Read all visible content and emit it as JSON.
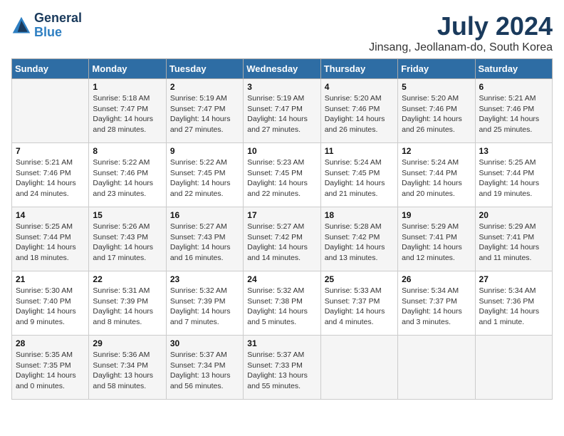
{
  "logo": {
    "general": "General",
    "blue": "Blue"
  },
  "header": {
    "month": "July 2024",
    "location": "Jinsang, Jeollanam-do, South Korea"
  },
  "weekdays": [
    "Sunday",
    "Monday",
    "Tuesday",
    "Wednesday",
    "Thursday",
    "Friday",
    "Saturday"
  ],
  "weeks": [
    [
      {
        "day": "",
        "sunrise": "",
        "sunset": "",
        "daylight": ""
      },
      {
        "day": "1",
        "sunrise": "Sunrise: 5:18 AM",
        "sunset": "Sunset: 7:47 PM",
        "daylight": "Daylight: 14 hours and 28 minutes."
      },
      {
        "day": "2",
        "sunrise": "Sunrise: 5:19 AM",
        "sunset": "Sunset: 7:47 PM",
        "daylight": "Daylight: 14 hours and 27 minutes."
      },
      {
        "day": "3",
        "sunrise": "Sunrise: 5:19 AM",
        "sunset": "Sunset: 7:47 PM",
        "daylight": "Daylight: 14 hours and 27 minutes."
      },
      {
        "day": "4",
        "sunrise": "Sunrise: 5:20 AM",
        "sunset": "Sunset: 7:46 PM",
        "daylight": "Daylight: 14 hours and 26 minutes."
      },
      {
        "day": "5",
        "sunrise": "Sunrise: 5:20 AM",
        "sunset": "Sunset: 7:46 PM",
        "daylight": "Daylight: 14 hours and 26 minutes."
      },
      {
        "day": "6",
        "sunrise": "Sunrise: 5:21 AM",
        "sunset": "Sunset: 7:46 PM",
        "daylight": "Daylight: 14 hours and 25 minutes."
      }
    ],
    [
      {
        "day": "7",
        "sunrise": "Sunrise: 5:21 AM",
        "sunset": "Sunset: 7:46 PM",
        "daylight": "Daylight: 14 hours and 24 minutes."
      },
      {
        "day": "8",
        "sunrise": "Sunrise: 5:22 AM",
        "sunset": "Sunset: 7:46 PM",
        "daylight": "Daylight: 14 hours and 23 minutes."
      },
      {
        "day": "9",
        "sunrise": "Sunrise: 5:22 AM",
        "sunset": "Sunset: 7:45 PM",
        "daylight": "Daylight: 14 hours and 22 minutes."
      },
      {
        "day": "10",
        "sunrise": "Sunrise: 5:23 AM",
        "sunset": "Sunset: 7:45 PM",
        "daylight": "Daylight: 14 hours and 22 minutes."
      },
      {
        "day": "11",
        "sunrise": "Sunrise: 5:24 AM",
        "sunset": "Sunset: 7:45 PM",
        "daylight": "Daylight: 14 hours and 21 minutes."
      },
      {
        "day": "12",
        "sunrise": "Sunrise: 5:24 AM",
        "sunset": "Sunset: 7:44 PM",
        "daylight": "Daylight: 14 hours and 20 minutes."
      },
      {
        "day": "13",
        "sunrise": "Sunrise: 5:25 AM",
        "sunset": "Sunset: 7:44 PM",
        "daylight": "Daylight: 14 hours and 19 minutes."
      }
    ],
    [
      {
        "day": "14",
        "sunrise": "Sunrise: 5:25 AM",
        "sunset": "Sunset: 7:44 PM",
        "daylight": "Daylight: 14 hours and 18 minutes."
      },
      {
        "day": "15",
        "sunrise": "Sunrise: 5:26 AM",
        "sunset": "Sunset: 7:43 PM",
        "daylight": "Daylight: 14 hours and 17 minutes."
      },
      {
        "day": "16",
        "sunrise": "Sunrise: 5:27 AM",
        "sunset": "Sunset: 7:43 PM",
        "daylight": "Daylight: 14 hours and 16 minutes."
      },
      {
        "day": "17",
        "sunrise": "Sunrise: 5:27 AM",
        "sunset": "Sunset: 7:42 PM",
        "daylight": "Daylight: 14 hours and 14 minutes."
      },
      {
        "day": "18",
        "sunrise": "Sunrise: 5:28 AM",
        "sunset": "Sunset: 7:42 PM",
        "daylight": "Daylight: 14 hours and 13 minutes."
      },
      {
        "day": "19",
        "sunrise": "Sunrise: 5:29 AM",
        "sunset": "Sunset: 7:41 PM",
        "daylight": "Daylight: 14 hours and 12 minutes."
      },
      {
        "day": "20",
        "sunrise": "Sunrise: 5:29 AM",
        "sunset": "Sunset: 7:41 PM",
        "daylight": "Daylight: 14 hours and 11 minutes."
      }
    ],
    [
      {
        "day": "21",
        "sunrise": "Sunrise: 5:30 AM",
        "sunset": "Sunset: 7:40 PM",
        "daylight": "Daylight: 14 hours and 9 minutes."
      },
      {
        "day": "22",
        "sunrise": "Sunrise: 5:31 AM",
        "sunset": "Sunset: 7:39 PM",
        "daylight": "Daylight: 14 hours and 8 minutes."
      },
      {
        "day": "23",
        "sunrise": "Sunrise: 5:32 AM",
        "sunset": "Sunset: 7:39 PM",
        "daylight": "Daylight: 14 hours and 7 minutes."
      },
      {
        "day": "24",
        "sunrise": "Sunrise: 5:32 AM",
        "sunset": "Sunset: 7:38 PM",
        "daylight": "Daylight: 14 hours and 5 minutes."
      },
      {
        "day": "25",
        "sunrise": "Sunrise: 5:33 AM",
        "sunset": "Sunset: 7:37 PM",
        "daylight": "Daylight: 14 hours and 4 minutes."
      },
      {
        "day": "26",
        "sunrise": "Sunrise: 5:34 AM",
        "sunset": "Sunset: 7:37 PM",
        "daylight": "Daylight: 14 hours and 3 minutes."
      },
      {
        "day": "27",
        "sunrise": "Sunrise: 5:34 AM",
        "sunset": "Sunset: 7:36 PM",
        "daylight": "Daylight: 14 hours and 1 minute."
      }
    ],
    [
      {
        "day": "28",
        "sunrise": "Sunrise: 5:35 AM",
        "sunset": "Sunset: 7:35 PM",
        "daylight": "Daylight: 14 hours and 0 minutes."
      },
      {
        "day": "29",
        "sunrise": "Sunrise: 5:36 AM",
        "sunset": "Sunset: 7:34 PM",
        "daylight": "Daylight: 13 hours and 58 minutes."
      },
      {
        "day": "30",
        "sunrise": "Sunrise: 5:37 AM",
        "sunset": "Sunset: 7:34 PM",
        "daylight": "Daylight: 13 hours and 56 minutes."
      },
      {
        "day": "31",
        "sunrise": "Sunrise: 5:37 AM",
        "sunset": "Sunset: 7:33 PM",
        "daylight": "Daylight: 13 hours and 55 minutes."
      },
      {
        "day": "",
        "sunrise": "",
        "sunset": "",
        "daylight": ""
      },
      {
        "day": "",
        "sunrise": "",
        "sunset": "",
        "daylight": ""
      },
      {
        "day": "",
        "sunrise": "",
        "sunset": "",
        "daylight": ""
      }
    ]
  ]
}
